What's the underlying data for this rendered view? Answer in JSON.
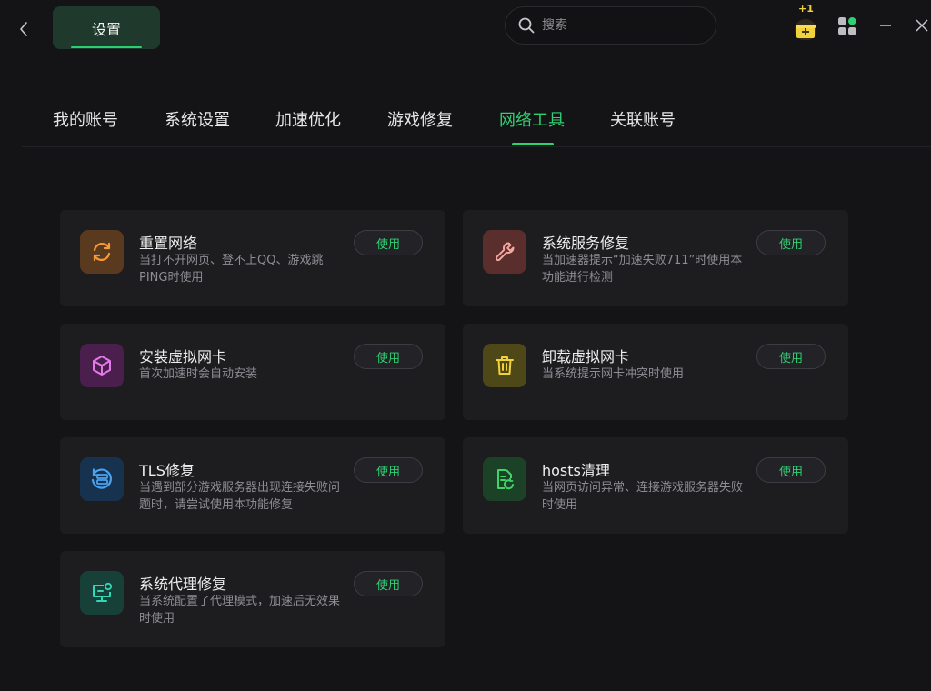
{
  "titlebar": {
    "title": "设置",
    "search_placeholder": "搜索",
    "gift_badge": "+1"
  },
  "nav": {
    "tabs": [
      "我的账号",
      "系统设置",
      "加速优化",
      "游戏修复",
      "网络工具",
      "关联账号"
    ],
    "active": "网络工具"
  },
  "cards": [
    {
      "title": "重置网络",
      "desc": "当打不开网页、登不上QQ、游戏跳PING时使用",
      "button": "使用",
      "icon": "refresh-icon",
      "icon_bg": "#5a3a1e",
      "icon_color": "#f59a3a"
    },
    {
      "title": "系统服务修复",
      "desc": "当加速器提示“加速失败711”时使用本功能进行检测",
      "button": "使用",
      "icon": "wrench-icon",
      "icon_bg": "#5a2e2c",
      "icon_color": "#f2a7a0"
    },
    {
      "title": "安装虚拟网卡",
      "desc": "首次加速时会自动安装",
      "button": "使用",
      "icon": "cube-icon",
      "icon_bg": "#4a1f4e",
      "icon_color": "#e27be8"
    },
    {
      "title": "卸载虚拟网卡",
      "desc": "当系统提示网卡冲突时使用",
      "button": "使用",
      "icon": "trash-icon",
      "icon_bg": "#4e4718",
      "icon_color": "#f2d23a"
    },
    {
      "title": "TLS修复",
      "desc": "当遇到部分游戏服务器出现连接失败问题时，请尝试使用本功能修复",
      "button": "使用",
      "icon": "server-refresh-icon",
      "icon_bg": "#17324e",
      "icon_color": "#4aa3f0"
    },
    {
      "title": "hosts清理",
      "desc": "当网页访问异常、连接游戏服务器失败时使用",
      "button": "使用",
      "icon": "file-clean-icon",
      "icon_bg": "#1b4226",
      "icon_color": "#3fd46a"
    },
    {
      "title": "系统代理修复",
      "desc": "当系统配置了代理模式，加速后无效果时使用",
      "button": "使用",
      "icon": "monitor-icon",
      "icon_bg": "#174038",
      "icon_color": "#33d6b5"
    }
  ],
  "colors": {
    "accent": "#2fd173",
    "background": "#141416",
    "card": "#1d1d20"
  }
}
